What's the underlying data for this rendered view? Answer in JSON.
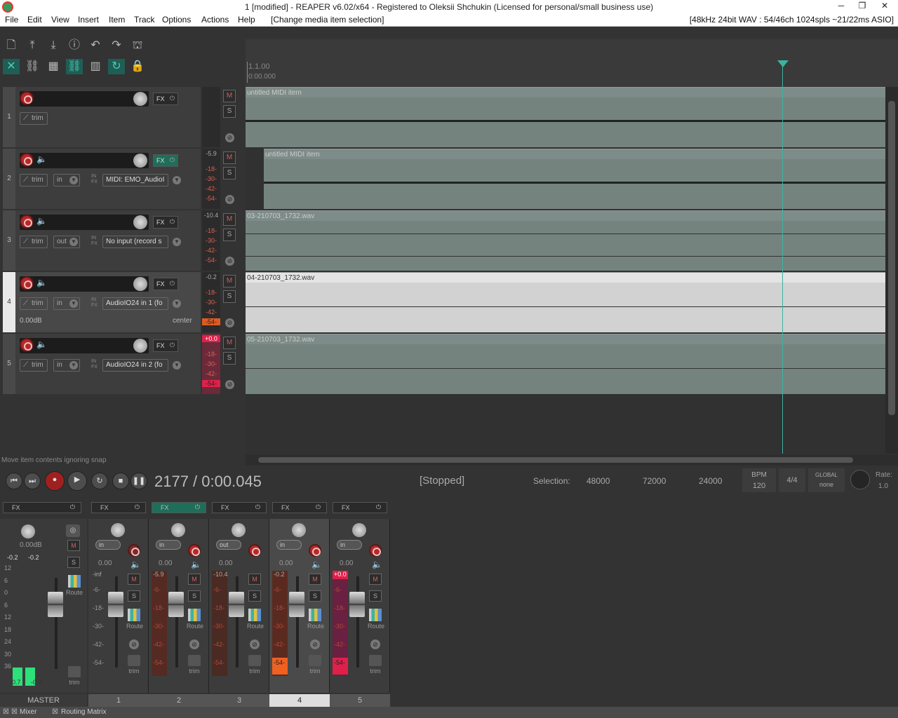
{
  "window": {
    "title": "1 [modified] - REAPER v6.02/x64 - Registered to Oleksii Shchukin (Licensed for personal/small business use)",
    "controls": [
      "─",
      "❐",
      "✕"
    ]
  },
  "menu": {
    "items": [
      "File",
      "Edit",
      "View",
      "Insert",
      "Item",
      "Track",
      "Options",
      "Actions",
      "Help"
    ],
    "last_action": "[Change media item selection]",
    "audio_status": "[48kHz 24bit WAV : 54/46ch 1024spls ~21/22ms ASIO]"
  },
  "ruler": {
    "bar": "1.1.00",
    "time": "0:00.000"
  },
  "tracks": [
    {
      "num": "1",
      "trim": "trim",
      "has_io": false,
      "fx_on": false,
      "meter_top": "",
      "meter_scale": []
    },
    {
      "num": "2",
      "trim": "trim",
      "io": "in",
      "input": "MIDI: EMO_AudioI",
      "fx_on": true,
      "meter_top": "-5.9",
      "meter_scale": [
        "-18-",
        "-30-",
        "-42-",
        "-54-"
      ]
    },
    {
      "num": "3",
      "trim": "trim",
      "io": "out",
      "input": "No input (record s",
      "fx_on": false,
      "meter_top": "-10.4",
      "meter_scale": [
        "-18-",
        "-30-",
        "-42-",
        "-54-"
      ]
    },
    {
      "num": "4",
      "trim": "trim",
      "io": "in",
      "input": "AudioIO24 in 1 (fo",
      "fx_on": false,
      "meter_top": "-0.2",
      "meter_scale": [
        "-18-",
        "-30-",
        "-42-",
        "-54-"
      ],
      "vol": "0.00dB",
      "pan": "center"
    },
    {
      "num": "5",
      "trim": "trim",
      "io": "in",
      "input": "AudioIO24 in 2 (fo",
      "fx_on": false,
      "meter_top": "+0.0",
      "meter_scale": [
        "-18-",
        "-30-",
        "-42-",
        "-54-"
      ]
    }
  ],
  "items": [
    {
      "name": "untitled MIDI item"
    },
    {
      "name": "untitled MIDI item"
    },
    {
      "name": "03-210703_1732.wav"
    },
    {
      "name": "04-210703_1732.wav"
    },
    {
      "name": "05-210703_1732.wav"
    }
  ],
  "hint": "Move item contents ignoring snap",
  "transport": {
    "position": "2177 / 0:00.045",
    "state": "[Stopped]",
    "selection_label": "Selection:",
    "sel_start": "48000",
    "sel_end": "72000",
    "sel_length": "24000",
    "bpm_label": "BPM",
    "bpm": "120",
    "timesig": "4/4",
    "global_label": "GLOBAL",
    "global_value": "none",
    "rate_label": "Rate:",
    "rate": "1.0"
  },
  "master": {
    "name": "MASTER",
    "fx": "FX",
    "vol": "0.00dB",
    "peak_l": "-0.2",
    "peak_r": "-0.2",
    "scale": [
      "12",
      "6",
      "0",
      "6",
      "12",
      "18",
      "24",
      "30",
      "36"
    ],
    "route": "Route",
    "trim": "trim",
    "clip_l": "-0.7",
    "clip_r": "-0.7"
  },
  "strips": [
    {
      "name": "1",
      "io": "in",
      "vol": "0.00",
      "peak": "-inf",
      "fx_on": false
    },
    {
      "name": "2",
      "io": "in",
      "vol": "0.00",
      "peak": "-5.9",
      "fx_on": true
    },
    {
      "name": "3",
      "io": "out",
      "vol": "0.00",
      "peak": "-10.4",
      "fx_on": false
    },
    {
      "name": "4",
      "io": "in",
      "vol": "0.00",
      "peak": "-0.2",
      "fx_on": false
    },
    {
      "name": "5",
      "io": "in",
      "vol": "0.00",
      "peak": "+0.0",
      "fx_on": false
    }
  ],
  "strip_labels": {
    "fx": "FX",
    "m": "M",
    "s": "S",
    "route": "Route",
    "trim": "trim",
    "scale": [
      "-6-",
      "-18-",
      "-30-",
      "-42-",
      "-54-"
    ]
  },
  "tabs": [
    "Mixer",
    "Routing Matrix"
  ],
  "colors": {
    "accent": "#3cb3a0",
    "rec": "#b62828",
    "item": "#7d8c88"
  }
}
